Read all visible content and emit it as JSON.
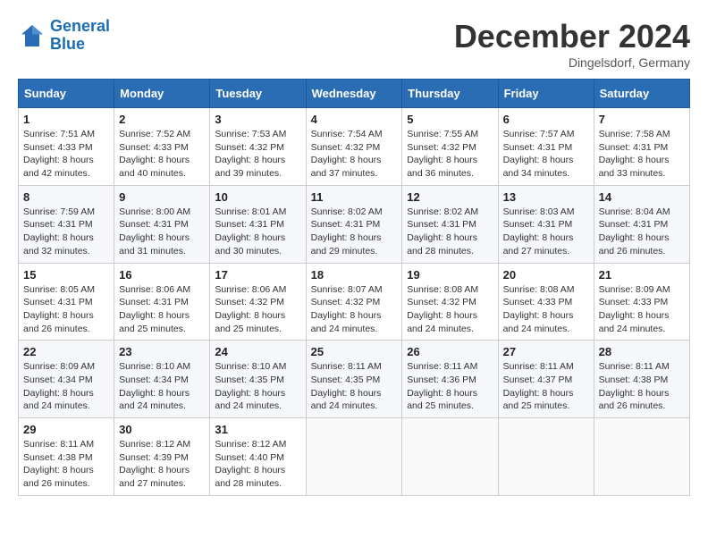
{
  "header": {
    "logo_line1": "General",
    "logo_line2": "Blue",
    "month": "December 2024",
    "location": "Dingelsdorf, Germany"
  },
  "weekdays": [
    "Sunday",
    "Monday",
    "Tuesday",
    "Wednesday",
    "Thursday",
    "Friday",
    "Saturday"
  ],
  "weeks": [
    [
      {
        "day": "1",
        "sunrise": "7:51 AM",
        "sunset": "4:33 PM",
        "daylight": "8 hours and 42 minutes."
      },
      {
        "day": "2",
        "sunrise": "7:52 AM",
        "sunset": "4:33 PM",
        "daylight": "8 hours and 40 minutes."
      },
      {
        "day": "3",
        "sunrise": "7:53 AM",
        "sunset": "4:32 PM",
        "daylight": "8 hours and 39 minutes."
      },
      {
        "day": "4",
        "sunrise": "7:54 AM",
        "sunset": "4:32 PM",
        "daylight": "8 hours and 37 minutes."
      },
      {
        "day": "5",
        "sunrise": "7:55 AM",
        "sunset": "4:32 PM",
        "daylight": "8 hours and 36 minutes."
      },
      {
        "day": "6",
        "sunrise": "7:57 AM",
        "sunset": "4:31 PM",
        "daylight": "8 hours and 34 minutes."
      },
      {
        "day": "7",
        "sunrise": "7:58 AM",
        "sunset": "4:31 PM",
        "daylight": "8 hours and 33 minutes."
      }
    ],
    [
      {
        "day": "8",
        "sunrise": "7:59 AM",
        "sunset": "4:31 PM",
        "daylight": "8 hours and 32 minutes."
      },
      {
        "day": "9",
        "sunrise": "8:00 AM",
        "sunset": "4:31 PM",
        "daylight": "8 hours and 31 minutes."
      },
      {
        "day": "10",
        "sunrise": "8:01 AM",
        "sunset": "4:31 PM",
        "daylight": "8 hours and 30 minutes."
      },
      {
        "day": "11",
        "sunrise": "8:02 AM",
        "sunset": "4:31 PM",
        "daylight": "8 hours and 29 minutes."
      },
      {
        "day": "12",
        "sunrise": "8:02 AM",
        "sunset": "4:31 PM",
        "daylight": "8 hours and 28 minutes."
      },
      {
        "day": "13",
        "sunrise": "8:03 AM",
        "sunset": "4:31 PM",
        "daylight": "8 hours and 27 minutes."
      },
      {
        "day": "14",
        "sunrise": "8:04 AM",
        "sunset": "4:31 PM",
        "daylight": "8 hours and 26 minutes."
      }
    ],
    [
      {
        "day": "15",
        "sunrise": "8:05 AM",
        "sunset": "4:31 PM",
        "daylight": "8 hours and 26 minutes."
      },
      {
        "day": "16",
        "sunrise": "8:06 AM",
        "sunset": "4:31 PM",
        "daylight": "8 hours and 25 minutes."
      },
      {
        "day": "17",
        "sunrise": "8:06 AM",
        "sunset": "4:32 PM",
        "daylight": "8 hours and 25 minutes."
      },
      {
        "day": "18",
        "sunrise": "8:07 AM",
        "sunset": "4:32 PM",
        "daylight": "8 hours and 24 minutes."
      },
      {
        "day": "19",
        "sunrise": "8:08 AM",
        "sunset": "4:32 PM",
        "daylight": "8 hours and 24 minutes."
      },
      {
        "day": "20",
        "sunrise": "8:08 AM",
        "sunset": "4:33 PM",
        "daylight": "8 hours and 24 minutes."
      },
      {
        "day": "21",
        "sunrise": "8:09 AM",
        "sunset": "4:33 PM",
        "daylight": "8 hours and 24 minutes."
      }
    ],
    [
      {
        "day": "22",
        "sunrise": "8:09 AM",
        "sunset": "4:34 PM",
        "daylight": "8 hours and 24 minutes."
      },
      {
        "day": "23",
        "sunrise": "8:10 AM",
        "sunset": "4:34 PM",
        "daylight": "8 hours and 24 minutes."
      },
      {
        "day": "24",
        "sunrise": "8:10 AM",
        "sunset": "4:35 PM",
        "daylight": "8 hours and 24 minutes."
      },
      {
        "day": "25",
        "sunrise": "8:11 AM",
        "sunset": "4:35 PM",
        "daylight": "8 hours and 24 minutes."
      },
      {
        "day": "26",
        "sunrise": "8:11 AM",
        "sunset": "4:36 PM",
        "daylight": "8 hours and 25 minutes."
      },
      {
        "day": "27",
        "sunrise": "8:11 AM",
        "sunset": "4:37 PM",
        "daylight": "8 hours and 25 minutes."
      },
      {
        "day": "28",
        "sunrise": "8:11 AM",
        "sunset": "4:38 PM",
        "daylight": "8 hours and 26 minutes."
      }
    ],
    [
      {
        "day": "29",
        "sunrise": "8:11 AM",
        "sunset": "4:38 PM",
        "daylight": "8 hours and 26 minutes."
      },
      {
        "day": "30",
        "sunrise": "8:12 AM",
        "sunset": "4:39 PM",
        "daylight": "8 hours and 27 minutes."
      },
      {
        "day": "31",
        "sunrise": "8:12 AM",
        "sunset": "4:40 PM",
        "daylight": "8 hours and 28 minutes."
      },
      null,
      null,
      null,
      null
    ]
  ],
  "labels": {
    "sunrise": "Sunrise:",
    "sunset": "Sunset:",
    "daylight": "Daylight:"
  }
}
